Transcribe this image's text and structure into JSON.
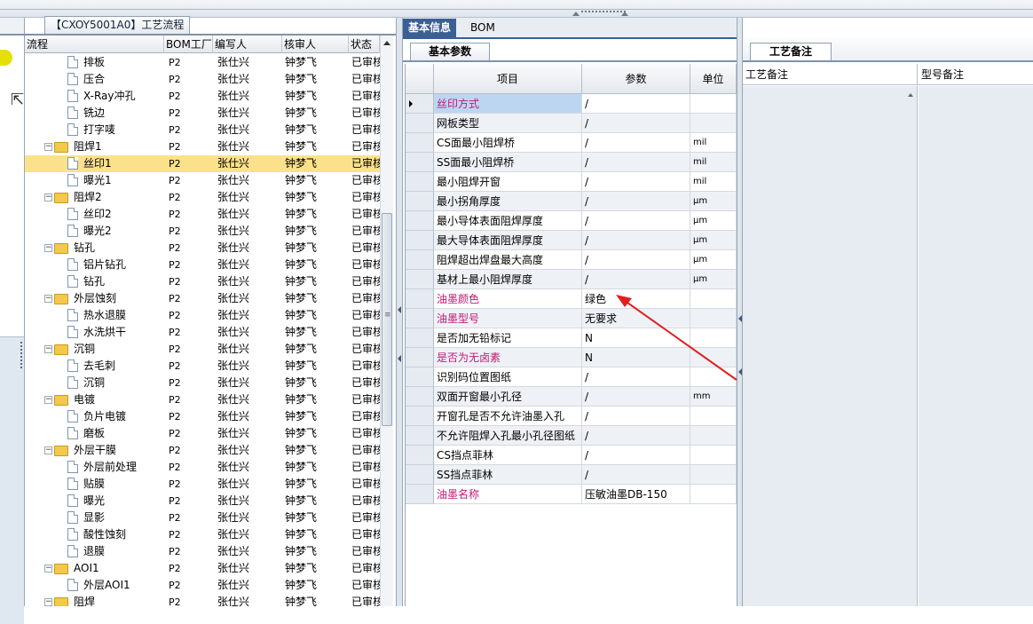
{
  "tree_panel": {
    "title": "【CXOY5001A0】工艺流程",
    "columns": [
      "流程",
      "BOM工厂",
      "编写人",
      "核审人",
      "状态"
    ],
    "rows": [
      {
        "indent": 2,
        "kind": "doc",
        "name": "排板",
        "bom": "P2",
        "writer": "张仕兴",
        "reviewer": "钟梦飞",
        "status": "已审核"
      },
      {
        "indent": 2,
        "kind": "doc",
        "name": "压合",
        "bom": "P2",
        "writer": "张仕兴",
        "reviewer": "钟梦飞",
        "status": "已审核"
      },
      {
        "indent": 2,
        "kind": "doc",
        "name": "X-Ray冲孔",
        "bom": "P2",
        "writer": "张仕兴",
        "reviewer": "钟梦飞",
        "status": "已审核"
      },
      {
        "indent": 2,
        "kind": "doc",
        "name": "铣边",
        "bom": "P2",
        "writer": "张仕兴",
        "reviewer": "钟梦飞",
        "status": "已审核"
      },
      {
        "indent": 2,
        "kind": "doc",
        "name": "打字唛",
        "bom": "P2",
        "writer": "张仕兴",
        "reviewer": "钟梦飞",
        "status": "已审核"
      },
      {
        "indent": 1,
        "kind": "folder",
        "name": "阻焊1",
        "bom": "P2",
        "writer": "张仕兴",
        "reviewer": "钟梦飞",
        "status": "已审核"
      },
      {
        "indent": 2,
        "kind": "doc",
        "name": "丝印1",
        "bom": "P2",
        "writer": "张仕兴",
        "reviewer": "钟梦飞",
        "status": "已审核",
        "selected": true
      },
      {
        "indent": 2,
        "kind": "doc",
        "name": "曝光1",
        "bom": "P2",
        "writer": "张仕兴",
        "reviewer": "钟梦飞",
        "status": "已审核"
      },
      {
        "indent": 1,
        "kind": "folder",
        "name": "阻焊2",
        "bom": "P2",
        "writer": "张仕兴",
        "reviewer": "钟梦飞",
        "status": "已审核"
      },
      {
        "indent": 2,
        "kind": "doc",
        "name": "丝印2",
        "bom": "P2",
        "writer": "张仕兴",
        "reviewer": "钟梦飞",
        "status": "已审核"
      },
      {
        "indent": 2,
        "kind": "doc",
        "name": "曝光2",
        "bom": "P2",
        "writer": "张仕兴",
        "reviewer": "钟梦飞",
        "status": "已审核"
      },
      {
        "indent": 1,
        "kind": "folder",
        "name": "钻孔",
        "bom": "P2",
        "writer": "张仕兴",
        "reviewer": "钟梦飞",
        "status": "已审核"
      },
      {
        "indent": 2,
        "kind": "doc",
        "name": "铝片钻孔",
        "bom": "P2",
        "writer": "张仕兴",
        "reviewer": "钟梦飞",
        "status": "已审核"
      },
      {
        "indent": 2,
        "kind": "doc",
        "name": "钻孔",
        "bom": "P2",
        "writer": "张仕兴",
        "reviewer": "钟梦飞",
        "status": "已审核"
      },
      {
        "indent": 1,
        "kind": "folder",
        "name": "外层蚀刻",
        "bom": "P2",
        "writer": "张仕兴",
        "reviewer": "钟梦飞",
        "status": "已审核"
      },
      {
        "indent": 2,
        "kind": "doc",
        "name": "热水退膜",
        "bom": "P2",
        "writer": "张仕兴",
        "reviewer": "钟梦飞",
        "status": "已审核"
      },
      {
        "indent": 2,
        "kind": "doc",
        "name": "水洗烘干",
        "bom": "P2",
        "writer": "张仕兴",
        "reviewer": "钟梦飞",
        "status": "已审核"
      },
      {
        "indent": 1,
        "kind": "folder",
        "name": "沉铜",
        "bom": "P2",
        "writer": "张仕兴",
        "reviewer": "钟梦飞",
        "status": "已审核"
      },
      {
        "indent": 2,
        "kind": "doc",
        "name": "去毛刺",
        "bom": "P2",
        "writer": "张仕兴",
        "reviewer": "钟梦飞",
        "status": "已审核"
      },
      {
        "indent": 2,
        "kind": "doc",
        "name": "沉铜",
        "bom": "P2",
        "writer": "张仕兴",
        "reviewer": "钟梦飞",
        "status": "已审核"
      },
      {
        "indent": 1,
        "kind": "folder",
        "name": "电镀",
        "bom": "P2",
        "writer": "张仕兴",
        "reviewer": "钟梦飞",
        "status": "已审核"
      },
      {
        "indent": 2,
        "kind": "doc",
        "name": "负片电镀",
        "bom": "P2",
        "writer": "张仕兴",
        "reviewer": "钟梦飞",
        "status": "已审核"
      },
      {
        "indent": 2,
        "kind": "doc",
        "name": "磨板",
        "bom": "P2",
        "writer": "张仕兴",
        "reviewer": "钟梦飞",
        "status": "已审核"
      },
      {
        "indent": 1,
        "kind": "folder",
        "name": "外层干膜",
        "bom": "P2",
        "writer": "张仕兴",
        "reviewer": "钟梦飞",
        "status": "已审核"
      },
      {
        "indent": 2,
        "kind": "doc",
        "name": "外层前处理",
        "bom": "P2",
        "writer": "张仕兴",
        "reviewer": "钟梦飞",
        "status": "已审核"
      },
      {
        "indent": 2,
        "kind": "doc",
        "name": "贴膜",
        "bom": "P2",
        "writer": "张仕兴",
        "reviewer": "钟梦飞",
        "status": "已审核"
      },
      {
        "indent": 2,
        "kind": "doc",
        "name": "曝光",
        "bom": "P2",
        "writer": "张仕兴",
        "reviewer": "钟梦飞",
        "status": "已审核"
      },
      {
        "indent": 2,
        "kind": "doc",
        "name": "显影",
        "bom": "P2",
        "writer": "张仕兴",
        "reviewer": "钟梦飞",
        "status": "已审核"
      },
      {
        "indent": 2,
        "kind": "doc",
        "name": "酸性蚀刻",
        "bom": "P2",
        "writer": "张仕兴",
        "reviewer": "钟梦飞",
        "status": "已审核"
      },
      {
        "indent": 2,
        "kind": "doc",
        "name": "退膜",
        "bom": "P2",
        "writer": "张仕兴",
        "reviewer": "钟梦飞",
        "status": "已审核"
      },
      {
        "indent": 1,
        "kind": "folder",
        "name": "AOI1",
        "bom": "P2",
        "writer": "张仕兴",
        "reviewer": "钟梦飞",
        "status": "已审核"
      },
      {
        "indent": 2,
        "kind": "doc",
        "name": "外层AOI1",
        "bom": "P2",
        "writer": "张仕兴",
        "reviewer": "钟梦飞",
        "status": "已审核"
      },
      {
        "indent": 1,
        "kind": "folder",
        "name": "阻焊",
        "bom": "P2",
        "writer": "张仕兴",
        "reviewer": "钟梦飞",
        "status": "已审核"
      }
    ]
  },
  "middle_panel": {
    "tabs": [
      "基本信息",
      "BOM"
    ],
    "active_tab": 0,
    "subtab": "基本参数",
    "columns": [
      "项目",
      "参数",
      "单位"
    ],
    "rows": [
      {
        "item": "丝印方式",
        "param": "/",
        "unit": "",
        "pink": true,
        "current": true
      },
      {
        "item": "网板类型",
        "param": "/",
        "unit": ""
      },
      {
        "item": "CS面最小阻焊桥",
        "param": "/",
        "unit": "mil"
      },
      {
        "item": "SS面最小阻焊桥",
        "param": "/",
        "unit": "mil"
      },
      {
        "item": "最小阻焊开窗",
        "param": "/",
        "unit": "mil"
      },
      {
        "item": "最小拐角厚度",
        "param": "/",
        "unit": "μm"
      },
      {
        "item": "最小导体表面阻焊厚度",
        "param": "/",
        "unit": "μm"
      },
      {
        "item": "最大导体表面阻焊厚度",
        "param": "/",
        "unit": "μm"
      },
      {
        "item": "阻焊超出焊盘最大高度",
        "param": "/",
        "unit": "μm"
      },
      {
        "item": "基材上最小阻焊厚度",
        "param": "/",
        "unit": "μm"
      },
      {
        "item": "油墨颜色",
        "param": "绿色",
        "unit": "",
        "pink": true
      },
      {
        "item": "油墨型号",
        "param": "无要求",
        "unit": "",
        "pink": true
      },
      {
        "item": "是否加无铅标记",
        "param": "N",
        "unit": ""
      },
      {
        "item": "是否为无卤素",
        "param": "N",
        "unit": "",
        "pink": true
      },
      {
        "item": "识别码位置图纸",
        "param": "/",
        "unit": ""
      },
      {
        "item": "双面开窗最小孔径",
        "param": "/",
        "unit": "mm"
      },
      {
        "item": "开窗孔是否不允许油墨入孔",
        "param": "/",
        "unit": ""
      },
      {
        "item": "不允许阻焊入孔最小孔径图纸",
        "param": "/",
        "unit": ""
      },
      {
        "item": "CS挡点菲林",
        "param": "/",
        "unit": ""
      },
      {
        "item": "SS挡点菲林",
        "param": "/",
        "unit": ""
      },
      {
        "item": "油墨名称",
        "param": "压敏油墨DB-150",
        "unit": "",
        "pink": true
      }
    ]
  },
  "right_panel": {
    "tab": "工艺备注",
    "columns": [
      "工艺备注",
      "型号备注"
    ]
  },
  "colors": {
    "accent": "#3a5f95",
    "selected_row": "#fbe18a",
    "pink_label": "#c21875",
    "annotation_arrow": "#e02020"
  },
  "icons": [
    "folder-icon",
    "document-icon",
    "expand-toggle-icon",
    "mouse-cursor-icon",
    "row-pointer-icon",
    "scroll-up-icon",
    "annotation-arrow"
  ]
}
